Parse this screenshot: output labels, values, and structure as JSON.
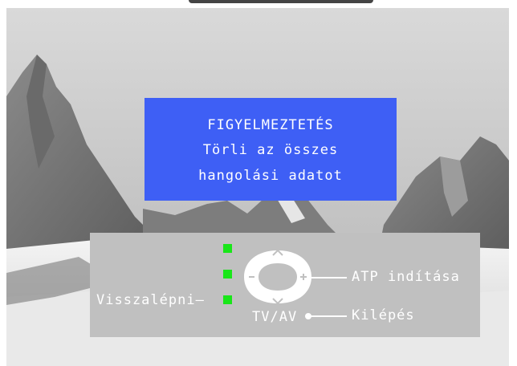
{
  "warning": {
    "title": "FIGYELMEZTETÉS",
    "line1": "Törli az összes",
    "line2": "hangolási adatot"
  },
  "controls": {
    "back_label": "Visszalépni",
    "atp_label": "ATP indítása",
    "exit_label": "Kilépés",
    "tvav_label": "TV/AV",
    "plus_symbol": "+",
    "minus_symbol": "–"
  },
  "colors": {
    "warning_bg": "#3e5ff5",
    "led_green": "#19e619",
    "panel_gray": "#c0c0c0"
  }
}
